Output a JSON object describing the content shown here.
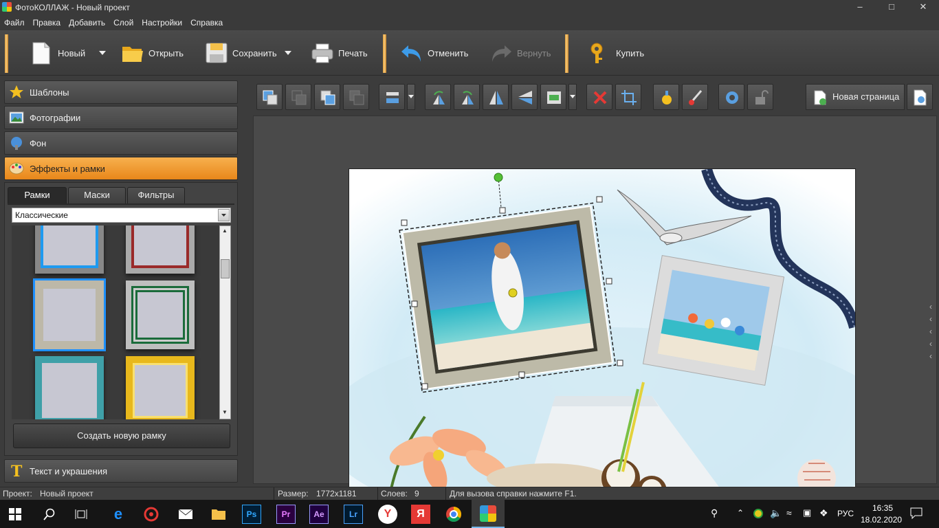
{
  "window": {
    "title": "ФотоКОЛЛАЖ - Новый проект"
  },
  "menu": [
    "Файл",
    "Правка",
    "Добавить",
    "Слой",
    "Настройки",
    "Справка"
  ],
  "toolbar": {
    "new_label": "Новый",
    "open_label": "Открыть",
    "save_label": "Сохранить",
    "print_label": "Печать",
    "undo_label": "Отменить",
    "redo_label": "Вернуть",
    "buy_label": "Купить"
  },
  "sidebar": {
    "templates": "Шаблоны",
    "photos": "Фотографии",
    "background": "Фон",
    "effects": "Эффекты и рамки",
    "text": "Текст и украшения",
    "tabs": [
      "Рамки",
      "Маски",
      "Фильтры"
    ],
    "selected_category": "Классические",
    "create_frame": "Создать новую рамку"
  },
  "editor": {
    "new_page": "Новая страница"
  },
  "status": {
    "project_label": "Проект:",
    "project_value": "Новый проект",
    "size_label": "Размер:",
    "size_value": "1772x1181",
    "layers_label": "Слоев:",
    "layers_value": "9",
    "help": "Для вызова справки нажмите F1."
  },
  "taskbar": {
    "lang": "РУС",
    "time": "16:35",
    "date": "18.02.2020",
    "apps": [
      "Ps",
      "Pr",
      "Ae",
      "Lr",
      "Я"
    ]
  },
  "colors": {
    "accent": "#f0a030",
    "active_section": "#f7b04e"
  }
}
